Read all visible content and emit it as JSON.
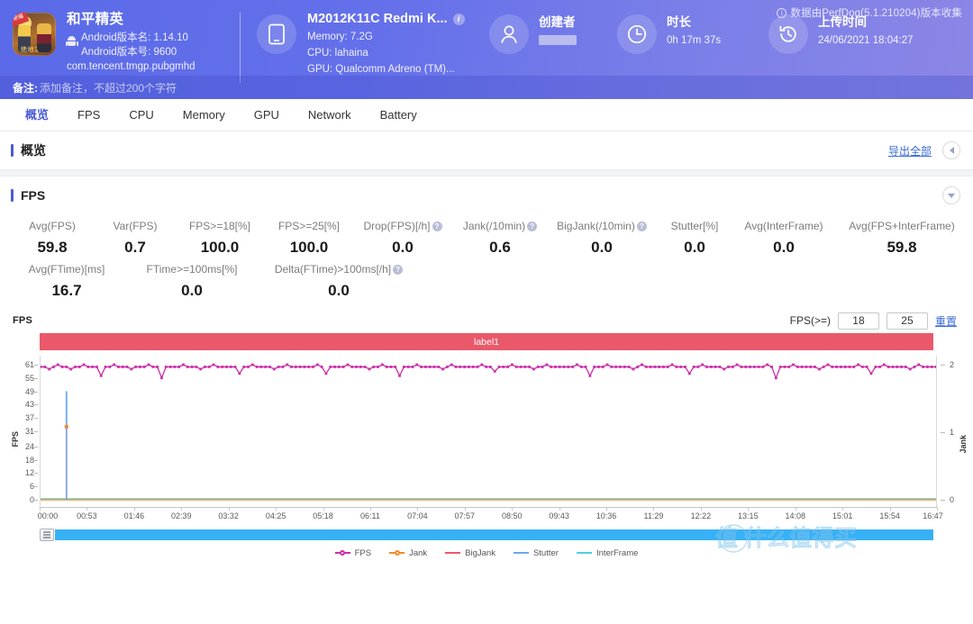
{
  "header": {
    "collect_note": "数据由PerfDog(5.1.210204)版本收集",
    "app": {
      "name": "和平精英",
      "android_version_name": "Android版本名: 1.14.10",
      "android_version_code": "Android版本号: 9600",
      "package": "com.tencent.tmgp.pubgmhd",
      "icon_tag": "荣耀",
      "icon_bottom": "绝地求生"
    },
    "device": {
      "model": "M2012K11C Redmi K...",
      "memory": "Memory: 7.2G",
      "cpu": "CPU: lahaina",
      "gpu": "GPU: Qualcomm Adreno (TM)..."
    },
    "creator": {
      "label": "创建者",
      "value": ""
    },
    "duration": {
      "label": "时长",
      "value": "0h 17m 37s"
    },
    "upload_time": {
      "label": "上传时间",
      "value": "24/06/2021 18:04:27"
    },
    "note": {
      "label": "备注:",
      "placeholder": "添加备注，不超过200个字符"
    }
  },
  "tabs": [
    {
      "label": "概览",
      "active": true
    },
    {
      "label": "FPS",
      "active": false
    },
    {
      "label": "CPU",
      "active": false
    },
    {
      "label": "Memory",
      "active": false
    },
    {
      "label": "GPU",
      "active": false
    },
    {
      "label": "Network",
      "active": false
    },
    {
      "label": "Battery",
      "active": false
    }
  ],
  "overview_panel": {
    "title": "概览",
    "export_all": "导出全部"
  },
  "fps_panel": {
    "title": "FPS",
    "stats_row1": [
      {
        "label": "Avg(FPS)",
        "value": "59.8",
        "help": false
      },
      {
        "label": "Var(FPS)",
        "value": "0.7",
        "help": false
      },
      {
        "label": "FPS>=18[%]",
        "value": "100.0",
        "help": false
      },
      {
        "label": "FPS>=25[%]",
        "value": "100.0",
        "help": false
      },
      {
        "label": "Drop(FPS)[/h]",
        "value": "0.0",
        "help": true
      },
      {
        "label": "Jank(/10min)",
        "value": "0.6",
        "help": true
      },
      {
        "label": "BigJank(/10min)",
        "value": "0.0",
        "help": true
      },
      {
        "label": "Stutter[%]",
        "value": "0.0",
        "help": false
      },
      {
        "label": "Avg(InterFrame)",
        "value": "0.0",
        "help": false
      },
      {
        "label": "Avg(FPS+InterFrame)",
        "value": "59.8",
        "help": false
      }
    ],
    "stats_row2": [
      {
        "label": "Avg(FTime)[ms]",
        "value": "16.7",
        "help": false
      },
      {
        "label": "FTime>=100ms[%]",
        "value": "0.0",
        "help": false
      },
      {
        "label": "Delta(FTime)>100ms[/h]",
        "value": "0.0",
        "help": true
      }
    ],
    "chart_header_label": "FPS",
    "threshold_label": "FPS(>=)",
    "threshold_1": "18",
    "threshold_2": "25",
    "reset_label": "重置",
    "band_label": "label1"
  },
  "watermark_text": "值 什么值得买",
  "colors": {
    "brand": "#4a5cd6",
    "fps": "#cc2fa8",
    "jank": "#f28c28",
    "bigjank": "#e9596a",
    "stutter": "#6aa9f0",
    "interframe": "#4dd0e1",
    "band": "#e9596a",
    "scrollbar": "#37b1f5"
  },
  "chart_data": {
    "type": "line",
    "title": "FPS",
    "xlabel": "",
    "ylabel": "FPS",
    "y2label": "Jank",
    "ylim": [
      0,
      61
    ],
    "y2lim": [
      0,
      2
    ],
    "yticks": [
      0,
      6,
      12,
      18,
      24,
      31,
      37,
      43,
      49,
      55,
      61
    ],
    "y2ticks": [
      0,
      1,
      2
    ],
    "grid": false,
    "legend_position": "bottom",
    "xticks": [
      "00:00",
      "00:53",
      "01:46",
      "02:39",
      "03:32",
      "04:25",
      "05:18",
      "06:11",
      "07:04",
      "07:57",
      "08:50",
      "09:43",
      "10:36",
      "11:29",
      "12:22",
      "13:15",
      "14:08",
      "15:01",
      "15:54",
      "16:47"
    ],
    "x_range_seconds": [
      0,
      1057
    ],
    "series": [
      {
        "name": "FPS",
        "color": "#cc2fa8",
        "summary": "near-constant 59-61 fps with occasional single-frame dips to 55-57 and a few drops to ~52",
        "values": [
          60,
          60,
          59,
          60,
          61,
          60,
          60,
          59,
          60,
          60,
          61,
          60,
          60,
          60,
          56,
          60,
          60,
          61,
          60,
          60,
          60,
          59,
          60,
          60,
          60,
          61,
          60,
          60,
          55,
          60,
          60,
          60,
          60,
          61,
          60,
          60,
          60,
          59,
          60,
          60,
          61,
          60,
          60,
          60,
          60,
          60,
          57,
          60,
          60,
          61,
          60,
          60,
          60,
          60,
          59,
          60,
          60,
          61,
          60,
          60,
          60,
          60,
          60,
          60,
          61,
          60,
          57,
          60,
          60,
          60,
          60,
          61,
          60,
          60,
          60,
          60,
          59,
          60,
          60,
          61,
          60,
          60,
          60,
          56,
          60,
          60,
          60,
          61,
          60,
          60,
          60,
          60,
          60,
          59,
          60,
          61,
          60,
          60,
          60,
          60,
          60,
          60,
          61,
          60,
          60,
          58,
          60,
          60,
          60,
          61,
          60,
          60,
          60,
          60,
          59,
          60,
          60,
          61,
          60,
          60,
          60,
          60,
          60,
          60,
          61,
          60,
          60,
          56,
          60,
          60,
          60,
          61,
          60,
          60,
          60,
          60,
          60,
          59,
          60,
          61,
          60,
          60,
          60,
          60,
          60,
          60,
          61,
          60,
          60,
          60,
          57,
          60,
          60,
          61,
          60,
          60,
          60,
          60,
          59,
          60,
          60,
          61,
          60,
          60,
          60,
          60,
          60,
          60,
          61,
          60,
          55,
          60,
          60,
          60,
          61,
          60,
          60,
          60,
          60,
          60,
          59,
          60,
          61,
          60,
          60,
          60,
          60,
          60,
          60,
          61,
          60,
          60,
          57,
          60,
          60,
          61,
          60,
          60,
          60,
          60,
          60,
          59,
          60,
          61,
          60,
          60,
          60,
          60
        ]
      },
      {
        "name": "Jank",
        "color": "#f28c28",
        "summary": "a single jank event of 1 near 00:06; zero elsewhere",
        "points": [
          {
            "x": "00:06",
            "y": 1
          }
        ]
      },
      {
        "name": "BigJank",
        "color": "#e9596a",
        "summary": "all zero",
        "points": []
      },
      {
        "name": "Stutter",
        "color": "#6aa9f0",
        "summary": "a single stutter spike reaching ~49 near 00:06",
        "points": [
          {
            "x": "00:06",
            "y": 49
          }
        ]
      },
      {
        "name": "InterFrame",
        "color": "#4dd0e1",
        "summary": "all zero",
        "points": []
      }
    ],
    "legend": [
      {
        "name": "FPS",
        "color": "#cc2fa8",
        "marker": true
      },
      {
        "name": "Jank",
        "color": "#f28c28",
        "marker": true
      },
      {
        "name": "BigJank",
        "color": "#e9596a",
        "marker": false
      },
      {
        "name": "Stutter",
        "color": "#6aa9f0",
        "marker": false
      },
      {
        "name": "InterFrame",
        "color": "#4dd0e1",
        "marker": false
      }
    ]
  }
}
